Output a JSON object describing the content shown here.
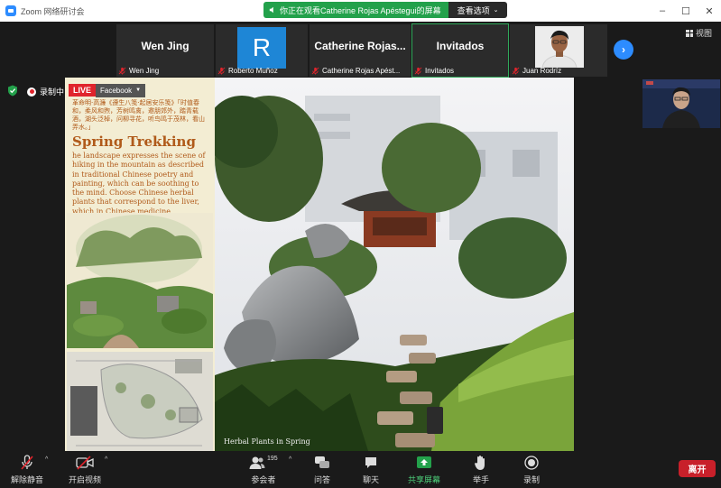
{
  "window": {
    "title": "Zoom 网络研讨会",
    "controls": [
      "–",
      "☐",
      "✕"
    ]
  },
  "share_banner": {
    "text": "你正在观看Catherine  Rojas  Apéstegui的屏幕",
    "view_options": "查看选项"
  },
  "participants": [
    {
      "display_name": "Wen Jing",
      "footer_name": "Wen Jing",
      "avatar": "name"
    },
    {
      "display_name": "R",
      "footer_name": "Roberto Muñoz",
      "avatar": "letter",
      "avatar_color": "#1e86d6"
    },
    {
      "display_name": "Catherine  Rojas...",
      "footer_name": "Catherine Rojas Apést...",
      "avatar": "name"
    },
    {
      "display_name": "Invitados",
      "footer_name": "Invitados",
      "avatar": "name",
      "active": true
    },
    {
      "display_name": "",
      "footer_name": "Juan Rodríz",
      "avatar": "photo"
    }
  ],
  "view_button": "视图",
  "recording": {
    "label": "录制中"
  },
  "shared_screen": {
    "live_badge": "LIVE",
    "platform": "Facebook",
    "poem": "革命明·高濂《遵生八笺·起居安乐笺》「时值春和，柔风和煦，芳树鸣禽，邀朋郊外，踏青载酒，湖头泛棹，问柳寻花，听鸟鸣于茂林，看山弄水。」",
    "title": "Spring Trekking",
    "body": "he landscape expresses the scene of hiking in the mountain as described in traditional Chinese poetry and painting, which can be soothing to the mind. Choose Chinese herbal plants that correspond to the liver, which in Chinese medicine corresponds to spring.",
    "caption": "Herbal Plants in Spring"
  },
  "toolbar": {
    "unmute": "解除静音",
    "start_video": "开启视频",
    "participants": "参会者",
    "participant_count": "195",
    "qa": "问答",
    "chat": "聊天",
    "share_screen": "共享屏幕",
    "raise_hand": "举手",
    "record": "录制",
    "leave": "离开"
  },
  "colors": {
    "accent_green": "#23a14b",
    "zoom_blue": "#2d8cff",
    "leave_red": "#c8202a",
    "live_red": "#e0242c",
    "panel_text": "#b05a1a"
  }
}
